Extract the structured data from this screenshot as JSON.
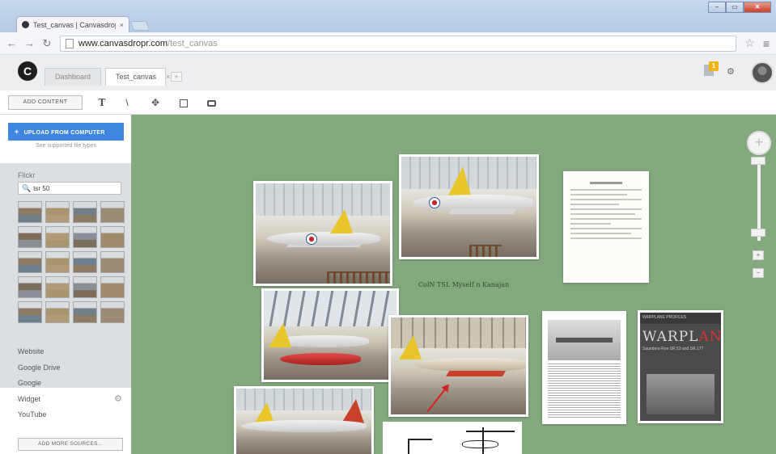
{
  "browser": {
    "tab_title": "Test_canvas | Canvasdrop",
    "tab_close": "×",
    "url_host": "www.canvasdropr.com",
    "url_path": "/test_canvas",
    "window_buttons": [
      "–",
      "▭",
      "✕"
    ]
  },
  "app": {
    "logo": "C",
    "tabs": [
      {
        "label": "Dashboard"
      },
      {
        "label": "Test_canvas"
      }
    ],
    "tab_close": "×",
    "tab_add": "+",
    "notification_count": "1"
  },
  "toolbar": {
    "add_content": "ADD CONTENT",
    "tools": [
      {
        "name": "text",
        "glyph": "T"
      },
      {
        "name": "pen",
        "glyph": "\\"
      },
      {
        "name": "move",
        "glyph": "✥"
      }
    ]
  },
  "sidebar": {
    "upload_plus": "+",
    "upload_label": "UPLOAD FROM COMPUTER",
    "upload_hint": "See supported file types",
    "flickr_label": "Flickr",
    "flickr_search_value": "tsr 50",
    "thumb_count": 20,
    "sources": [
      "Website",
      "Google Drive",
      "Google",
      "Widget",
      "YouTube"
    ],
    "add_more": "ADD MORE SOURCES..."
  },
  "canvas": {
    "caption": "ColN TSL Myself n Kanajan",
    "zoom_level": 0.9,
    "zoom_plus": "+",
    "zoom_minus": "−"
  },
  "warplane": {
    "header": "WARPLANE PROFILES",
    "title_main": "WARPL",
    "title_accent": "ANES",
    "subtitle": "Saunders-Roe SR.53 and SR.177"
  },
  "colors": {
    "canvas_bg": "#85a97f",
    "upload_blue": "#3e86e0",
    "badge": "#f3b312",
    "arrow": "#d62020"
  }
}
